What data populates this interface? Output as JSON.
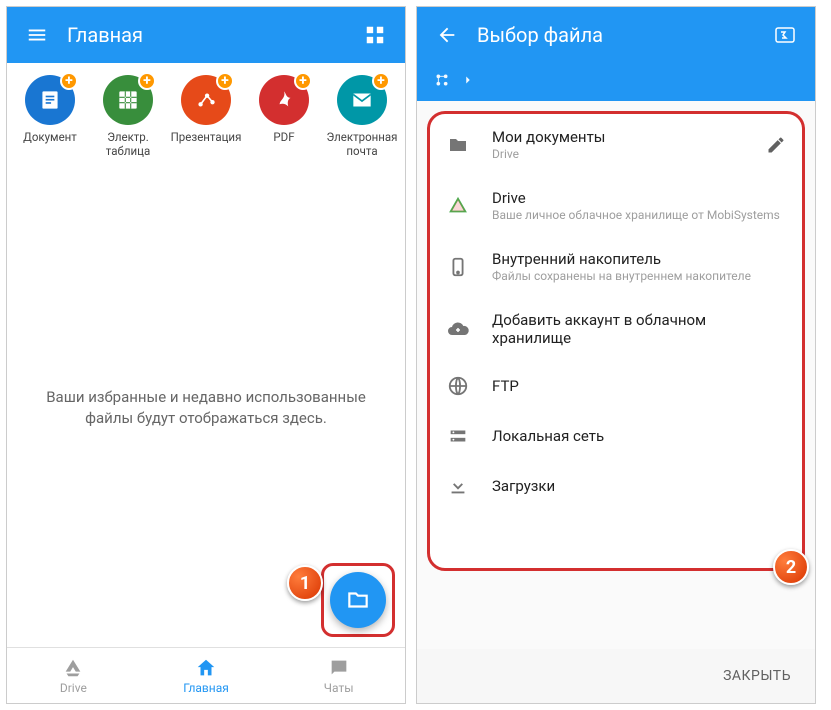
{
  "left": {
    "title": "Главная",
    "shortcuts": [
      {
        "label": "Документ",
        "color": "#1976d2"
      },
      {
        "label": "Электр. таблица",
        "color": "#388e3c"
      },
      {
        "label": "Презентация",
        "color": "#e64a19"
      },
      {
        "label": "PDF",
        "color": "#d32f2f"
      },
      {
        "label": "Электронная почта",
        "color": "#0097a7"
      }
    ],
    "empty": "Ваши избранные и недавно использованные файлы будут отображаться здесь.",
    "nav": [
      {
        "label": "Drive"
      },
      {
        "label": "Главная"
      },
      {
        "label": "Чаты"
      }
    ]
  },
  "right": {
    "title": "Выбор файла",
    "items": [
      {
        "title": "Мои документы",
        "sub": "Drive",
        "edit": true
      },
      {
        "title": "Drive",
        "sub": "Ваше личное облачное хранилище от MobiSystems"
      },
      {
        "title": "Внутренний накопитель",
        "sub": "Файлы сохранены на внутреннем накопителе"
      },
      {
        "title": "Добавить аккаунт в облачном хранилище"
      },
      {
        "title": "FTP"
      },
      {
        "title": "Локальная сеть"
      },
      {
        "title": "Загрузки"
      }
    ],
    "close": "ЗАКРЫТЬ"
  },
  "markers": {
    "one": "1",
    "two": "2"
  }
}
